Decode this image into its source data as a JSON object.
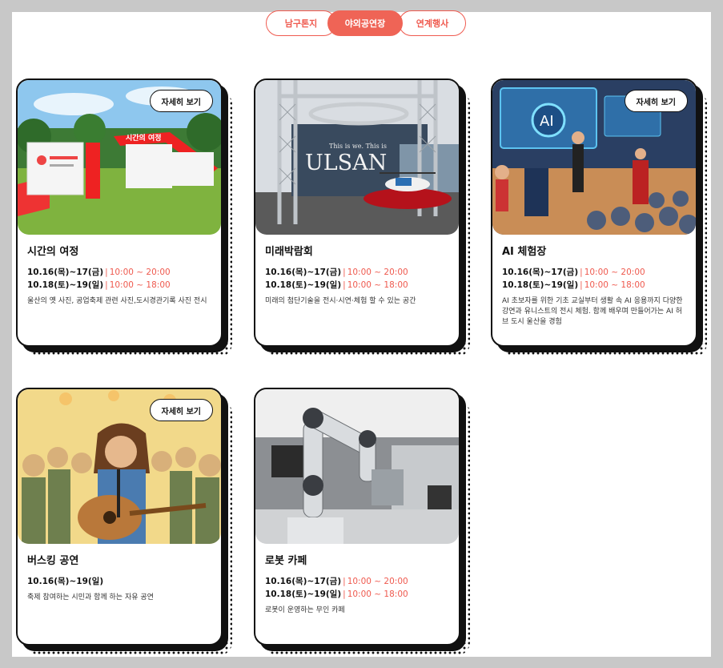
{
  "tabs": [
    {
      "label": "남구톤지"
    },
    {
      "label": "야외공연장"
    },
    {
      "label": "연계행사"
    }
  ],
  "detail_label": "자세히 보기",
  "cards": [
    {
      "title": "시간의 여정",
      "date1": "10.16(목)~17(금)",
      "time1": "10:00 ~ 20:00",
      "date2": "10.18(토)~19(일)",
      "time2": "10:00 ~ 18:00",
      "desc": "울산의 옛 사진, 공업축제 관련 사진,도시경관기록 사진 전시",
      "thumb_text": "시간의 여정"
    },
    {
      "title": "미래박람회",
      "date1": "10.16(목)~17(금)",
      "time1": "10:00 ~ 20:00",
      "date2": "10.18(토)~19(일)",
      "time2": "10:00 ~ 18:00",
      "desc": "미래의 첨단기술을 전시·시연·체험 할 수 있는 공간",
      "thumb_text": "ULSAN",
      "thumb_sub": "This is we. This is"
    },
    {
      "title": "AI 체험장",
      "date1": "10.16(목)~17(금)",
      "time1": "10:00 ~ 20:00",
      "date2": "10.18(토)~19(일)",
      "time2": "10:00 ~ 18:00",
      "desc": "AI 초보자를 위한 기초 교실부터 생활 속 AI 응용까지 다양한 강연과 유니스트의 전시 체험. 함께 배우며 만들어가는 AI 허브 도시 울산을 경험",
      "thumb_text": "AI"
    },
    {
      "title": "버스킹 공연",
      "date1": "10.16(목)~19(일)",
      "desc": "축제 참여하는 시민과 함께 하는 자유 공연"
    },
    {
      "title": "로봇 카페",
      "date1": "10.16(목)~17(금)",
      "time1": "10:00 ~ 20:00",
      "date2": "10.18(토)~19(일)",
      "time2": "10:00 ~ 18:00",
      "desc": "로봇이 운영하는 무인 카페"
    }
  ],
  "colors": {
    "accent": "#ef5a4f",
    "border": "#111111"
  }
}
